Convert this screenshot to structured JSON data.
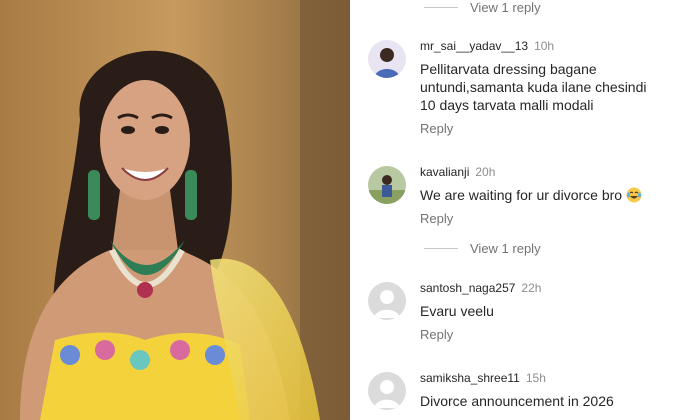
{
  "comments": [
    {
      "username": "mr_sai__yadav__13",
      "time": "10h",
      "text_lines": [
        "Pellitarvata dressing bagane",
        "untundi,samanta kuda ilane chesindi",
        "10 days tarvata malli modali"
      ],
      "reply": "Reply",
      "avatar": "profile-photo"
    },
    {
      "username": "kavalianji",
      "time": "20h",
      "text": "We are waiting for ur divorce bro",
      "emoji": "laughing-crying-emoji",
      "reply": "Reply",
      "avatar": "profile-photo"
    },
    {
      "username": "santosh_naga257",
      "time": "22h",
      "text": "Evaru veelu",
      "reply": "Reply",
      "avatar": "default-avatar"
    },
    {
      "username": "samiksha_shree11",
      "time": "15h",
      "text": "Divorce announcement in 2026",
      "avatar": "default-avatar"
    }
  ],
  "view_replies": [
    "View 1 reply",
    "View 1 reply"
  ],
  "colors": {
    "text": "#262626",
    "muted": "#8e8e8e",
    "reply": "#737373",
    "photo_bg": "#b88a52",
    "dress": "#f4d23c"
  }
}
